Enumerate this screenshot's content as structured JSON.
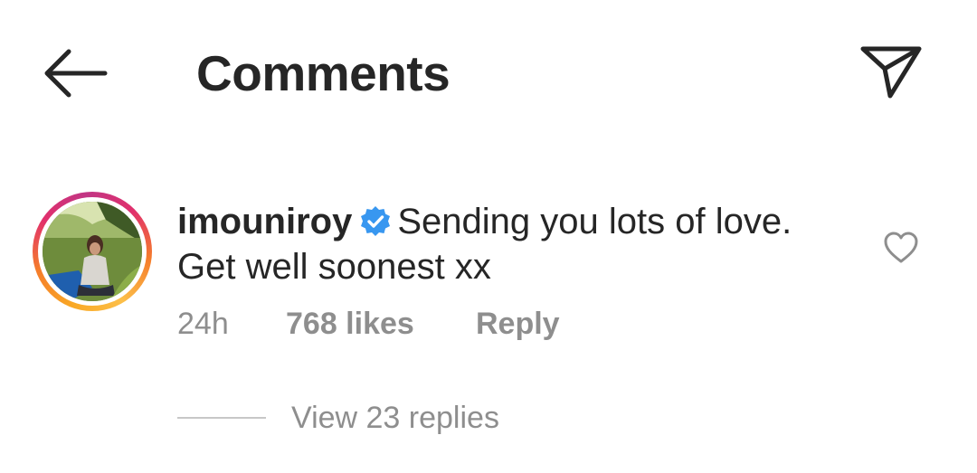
{
  "header": {
    "back_icon": "arrow-left-icon",
    "title": "Comments",
    "share_icon": "direct-send-icon"
  },
  "comment": {
    "avatar_ring_colors": [
      "#f9a825",
      "#e1306c",
      "#c13584"
    ],
    "username": "imouniroy",
    "verified_icon": "verified-badge-icon",
    "verified_color": "#3897f0",
    "text": "Sending you lots of love. Get well soonest xx",
    "timestamp": "24h",
    "likes": "768 likes",
    "reply_label": "Reply",
    "like_icon": "heart-outline-icon",
    "view_replies": "View 23 replies"
  },
  "colors": {
    "primary_text": "#262626",
    "secondary_text": "#8e8e8e",
    "divider": "#c7c7c7"
  }
}
